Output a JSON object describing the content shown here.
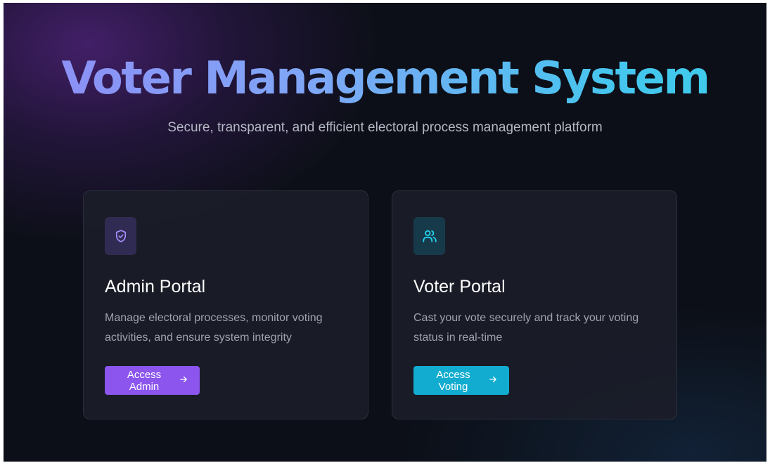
{
  "header": {
    "title": "Voter Management System",
    "subtitle": "Secure, transparent, and efficient electoral process management platform"
  },
  "cards": [
    {
      "icon": "shield-check-icon",
      "title": "Admin Portal",
      "description": "Manage electoral processes, monitor voting activities, and ensure system integrity",
      "button_label": "Access Admin",
      "button_icon": "arrow-right-icon",
      "accent": "#8b55ee"
    },
    {
      "icon": "users-icon",
      "title": "Voter Portal",
      "description": "Cast your vote securely and track your voting status in real-time",
      "button_label": "Access Voting",
      "button_icon": "arrow-right-icon",
      "accent": "#12acd0"
    }
  ],
  "colors": {
    "background": "#0c0f17",
    "title_gradient_start": "#8f8cf5",
    "title_gradient_end": "#3ccce9",
    "card_background": "#1b1e29",
    "admin_icon": "#a78bfa",
    "voter_icon": "#22d3ee"
  }
}
